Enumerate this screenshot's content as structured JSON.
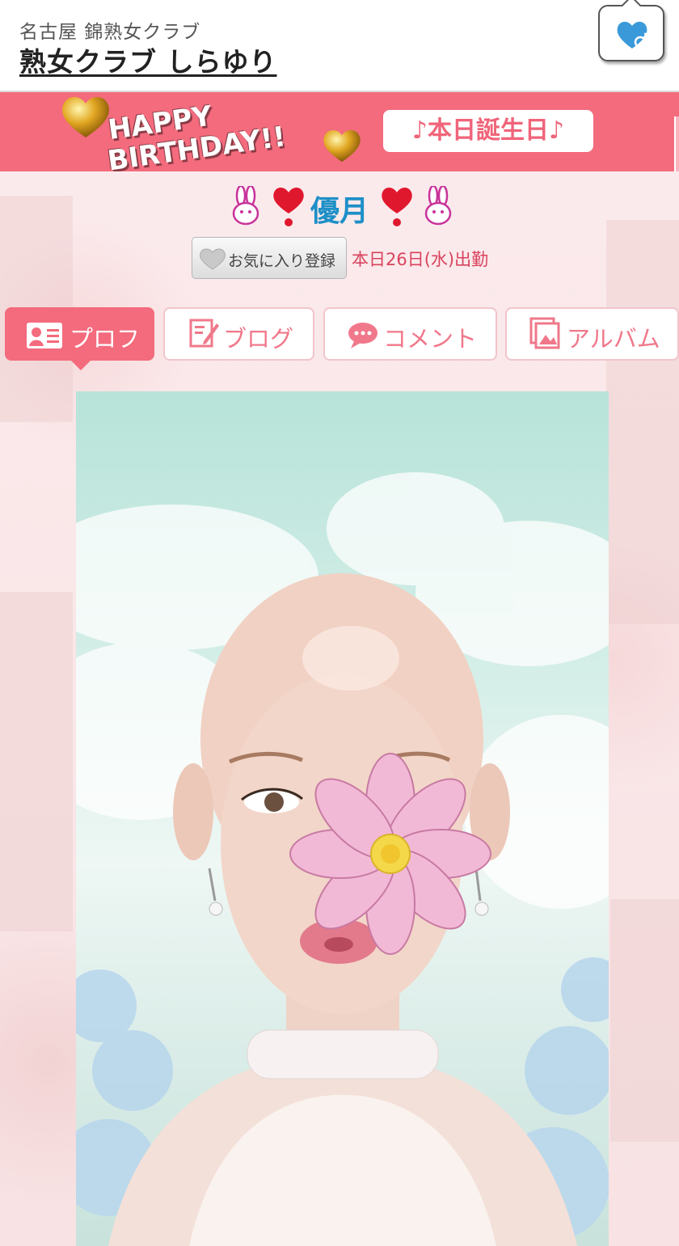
{
  "header": {
    "subtitle": "名古屋 錦熟女クラブ",
    "title": "熟女クラブ しらゆり",
    "favorite_icon": "heart-male-icon"
  },
  "banner": {
    "happy": "HAPPY",
    "birthday": "BIRTHDAY!!",
    "pill": "♪本日誕生日♪"
  },
  "profile": {
    "name": "優月",
    "favorite_label": "お気に入り登録",
    "attendance": "本日26日(水)出勤"
  },
  "tabs": [
    {
      "label": "プロフ",
      "icon": "profile-card-icon",
      "active": true
    },
    {
      "label": "ブログ",
      "icon": "blog-edit-icon",
      "active": false
    },
    {
      "label": "コメント",
      "icon": "comment-bubble-icon",
      "active": false
    },
    {
      "label": "アルバム",
      "icon": "album-icon",
      "active": false
    }
  ],
  "colors": {
    "accent": "#f36b7d",
    "name": "#1e8fc7",
    "attendance": "#d8435e"
  }
}
